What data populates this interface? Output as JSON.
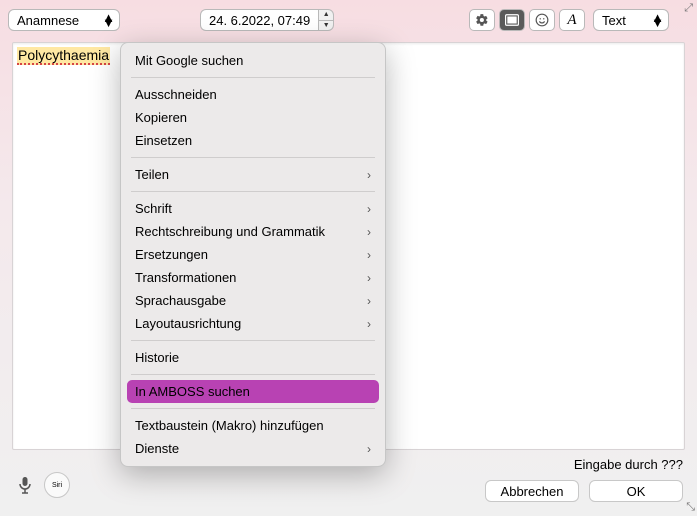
{
  "toolbar": {
    "category_selected": "Anamnese",
    "date_value": "24.  6.2022, 07:49",
    "format_selected": "Text"
  },
  "editor": {
    "selected_text": "Polycythaemia"
  },
  "footer": {
    "input_by": "Eingabe durch ???",
    "cancel_label": "Abbrechen",
    "ok_label": "OK"
  },
  "menu": {
    "google_search": "Mit Google suchen",
    "cut": "Ausschneiden",
    "copy": "Kopieren",
    "paste": "Einsetzen",
    "share": "Teilen",
    "font": "Schrift",
    "spelling": "Rechtschreibung und Grammatik",
    "substitutions": "Ersetzungen",
    "transformations": "Transformationen",
    "speech": "Sprachausgabe",
    "layout": "Layoutausrichtung",
    "history": "Historie",
    "amboss": "In AMBOSS suchen",
    "macro": "Textbaustein (Makro) hinzufügen",
    "services": "Dienste"
  }
}
